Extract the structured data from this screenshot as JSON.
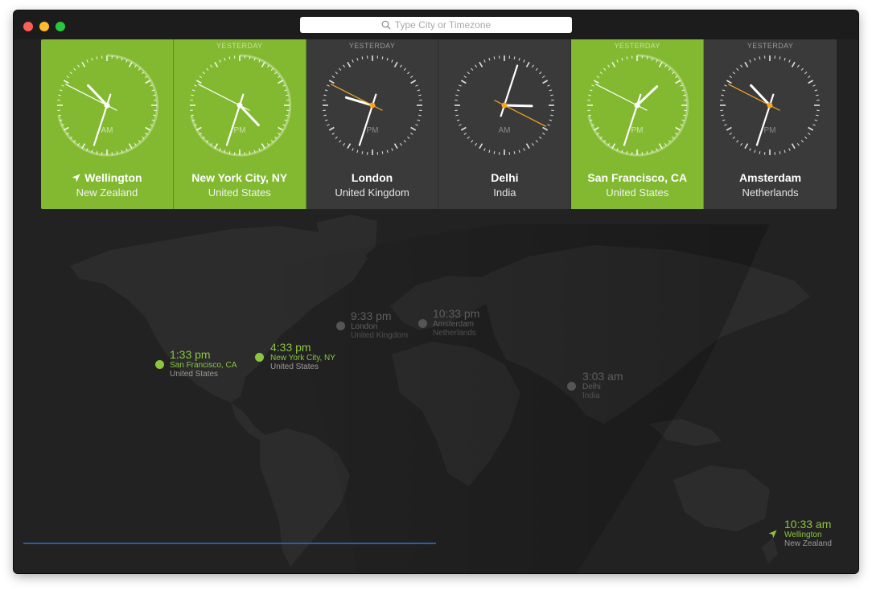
{
  "window": {
    "controls": [
      "close",
      "minimize",
      "zoom"
    ]
  },
  "search": {
    "placeholder": "Type City or Timezone",
    "icon": "magnifier-icon"
  },
  "colors": {
    "day": "#82b930",
    "night": "#3a3a3a",
    "accent_hand": "#f5a623",
    "map_land": "#2b2b2b",
    "progress": "#2a5dab"
  },
  "clocks": [
    {
      "city": "Wellington",
      "country": "New Zealand",
      "yesterday": "",
      "ampm": "AM",
      "is_day": true,
      "current_location": true,
      "hour": 10,
      "minute": 33
    },
    {
      "city": "New York City, NY",
      "country": "United States",
      "yesterday": "YESTERDAY",
      "ampm": "PM",
      "is_day": true,
      "current_location": false,
      "hour": 4,
      "minute": 33
    },
    {
      "city": "London",
      "country": "United Kingdom",
      "yesterday": "YESTERDAY",
      "ampm": "PM",
      "is_day": false,
      "current_location": false,
      "hour": 9,
      "minute": 33
    },
    {
      "city": "Delhi",
      "country": "India",
      "yesterday": "",
      "ampm": "AM",
      "is_day": false,
      "current_location": false,
      "hour": 3,
      "minute": 3
    },
    {
      "city": "San Francisco, CA",
      "country": "United States",
      "yesterday": "YESTERDAY",
      "ampm": "PM",
      "is_day": true,
      "current_location": false,
      "hour": 1,
      "minute": 33
    },
    {
      "city": "Amsterdam",
      "country": "Netherlands",
      "yesterday": "YESTERDAY",
      "ampm": "PM",
      "is_day": false,
      "current_location": false,
      "hour": 10,
      "minute": 33
    }
  ],
  "map_pins": {
    "san_francisco": {
      "time": "1:33 pm",
      "city": "San Francisco, CA",
      "country": "United States"
    },
    "new_york": {
      "time": "4:33 pm",
      "city": "New York City, NY",
      "country": "United States"
    },
    "london": {
      "time": "9:33 pm",
      "city": "London",
      "country": "United Kingdom"
    },
    "amsterdam": {
      "time": "10:33 pm",
      "city": "Amsterdam",
      "country": "Netherlands"
    },
    "delhi": {
      "time": "3:03 am",
      "city": "Delhi",
      "country": "India"
    },
    "wellington": {
      "time": "10:33 am",
      "city": "Wellington",
      "country": "New Zealand"
    }
  }
}
